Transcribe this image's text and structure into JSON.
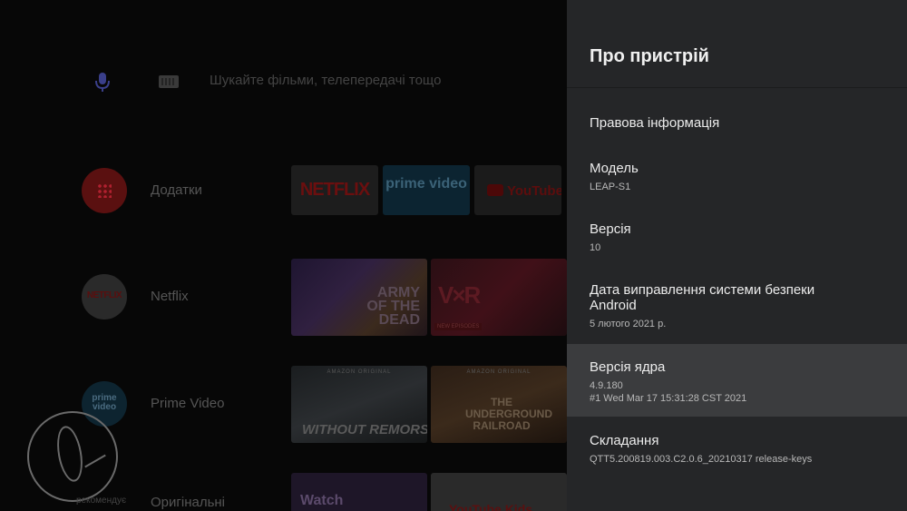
{
  "home": {
    "search_placeholder": "Шукайте фільми, телепередачі тощо",
    "rows": [
      {
        "label": "Додатки"
      },
      {
        "label": "Netflix"
      },
      {
        "label": "Prime Video"
      },
      {
        "label": "Оригінальні"
      }
    ],
    "row_icons": {
      "netflix": "NETFLIX",
      "prime": "prime video"
    },
    "tiles": {
      "netflix": "NETFLIX",
      "prime": "prime video",
      "youtube": "YouTube",
      "army": "ARMY OF THE DEAD",
      "love": "LOVE DEATH + ROBOTS",
      "love_badge": "NEW EPISODES",
      "wr_tag": "AMAZON ORIGINAL",
      "wr_title": "WITHOUT REMORSE",
      "ug_tag": "AMAZON ORIGINAL",
      "ug_title": "THE UNDERGROUND RAILROAD",
      "watch": "Watch",
      "ytkids": "YouTube Kids"
    },
    "watermark_text": "рекомендує"
  },
  "panel": {
    "title": "Про пристрій",
    "items": [
      {
        "label": "Правова інформація"
      },
      {
        "label": "Модель",
        "value": "LEAP-S1"
      },
      {
        "label": "Версія",
        "value": "10"
      },
      {
        "label": "Дата виправлення системи безпеки Android",
        "value": "5 лютого 2021 р."
      },
      {
        "label": "Версія ядра",
        "value": "4.9.180",
        "value2": "#1 Wed Mar 17 15:31:28 CST 2021",
        "selected": true
      },
      {
        "label": "Складання",
        "value": "QTT5.200819.003.C2.0.6_20210317 release-keys"
      }
    ]
  },
  "colors": {
    "panel_bg": "#252628",
    "selected_bg": "#3b3c3e",
    "text_primary": "#ececec",
    "text_secondary": "#b8b8b8"
  }
}
